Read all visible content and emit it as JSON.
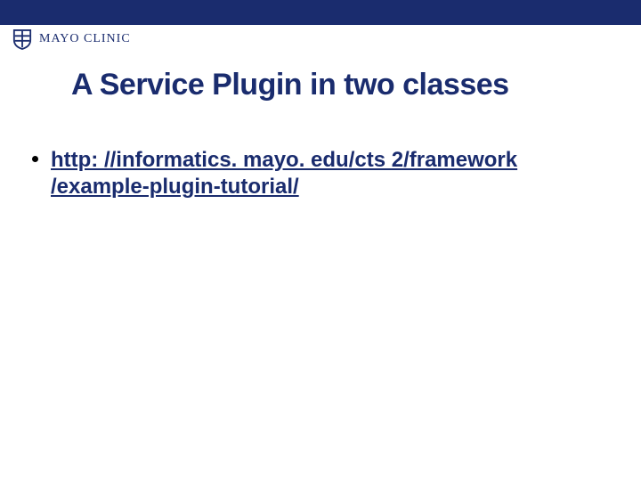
{
  "header": {
    "brand_text": "MAYO CLINIC",
    "shield_icon": "mayo-shield"
  },
  "title": "A Service Plugin in two classes",
  "body": {
    "bullets": [
      {
        "link_text": "http: //informatics. mayo. edu/cts 2/framework /example-plugin-tutorial/",
        "href": "http://informatics.mayo.edu/cts2/framework/example-plugin-tutorial/"
      }
    ]
  },
  "colors": {
    "brand_blue": "#1a2c6e"
  }
}
